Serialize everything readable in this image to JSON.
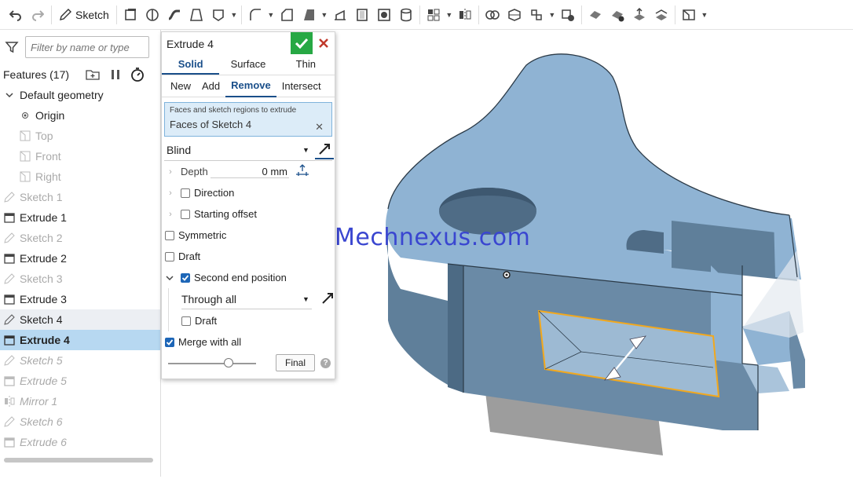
{
  "toolbar": {
    "sketch_label": "Sketch"
  },
  "sidebar": {
    "filter_placeholder": "Filter by name or type",
    "features_label": "Features (17)",
    "items": [
      {
        "label": "Default geometry"
      },
      {
        "label": "Origin"
      },
      {
        "label": "Top"
      },
      {
        "label": "Front"
      },
      {
        "label": "Right"
      },
      {
        "label": "Sketch 1"
      },
      {
        "label": "Extrude 1"
      },
      {
        "label": "Sketch 2"
      },
      {
        "label": "Extrude 2"
      },
      {
        "label": "Sketch 3"
      },
      {
        "label": "Extrude 3"
      },
      {
        "label": "Sketch 4"
      },
      {
        "label": "Extrude 4"
      },
      {
        "label": "Sketch 5"
      },
      {
        "label": "Extrude 5"
      },
      {
        "label": "Mirror 1"
      },
      {
        "label": "Sketch 6"
      },
      {
        "label": "Extrude 6"
      }
    ]
  },
  "dialog": {
    "title": "Extrude 4",
    "tabs": [
      "Solid",
      "Surface",
      "Thin"
    ],
    "op_tabs": [
      "New",
      "Add",
      "Remove",
      "Intersect"
    ],
    "faces_label": "Faces and sketch regions to extrude",
    "faces_value": "Faces of Sketch 4",
    "end_type": "Blind",
    "depth_label": "Depth",
    "depth_value": "0 mm",
    "direction_label": "Direction",
    "starting_offset_label": "Starting offset",
    "symmetric_label": "Symmetric",
    "draft_label": "Draft",
    "second_end_label": "Second end position",
    "second_end_type": "Through all",
    "draft2_label": "Draft",
    "merge_label": "Merge with all",
    "final_label": "Final",
    "help_glyph": "?"
  },
  "watermark": "Mechnexus.com",
  "colors": {
    "part_top": "#8fb3d3",
    "part_side": "#5f7f9a",
    "selection": "#f2a81d",
    "accent": "#1a4f8a",
    "ok_green": "#27a844"
  }
}
